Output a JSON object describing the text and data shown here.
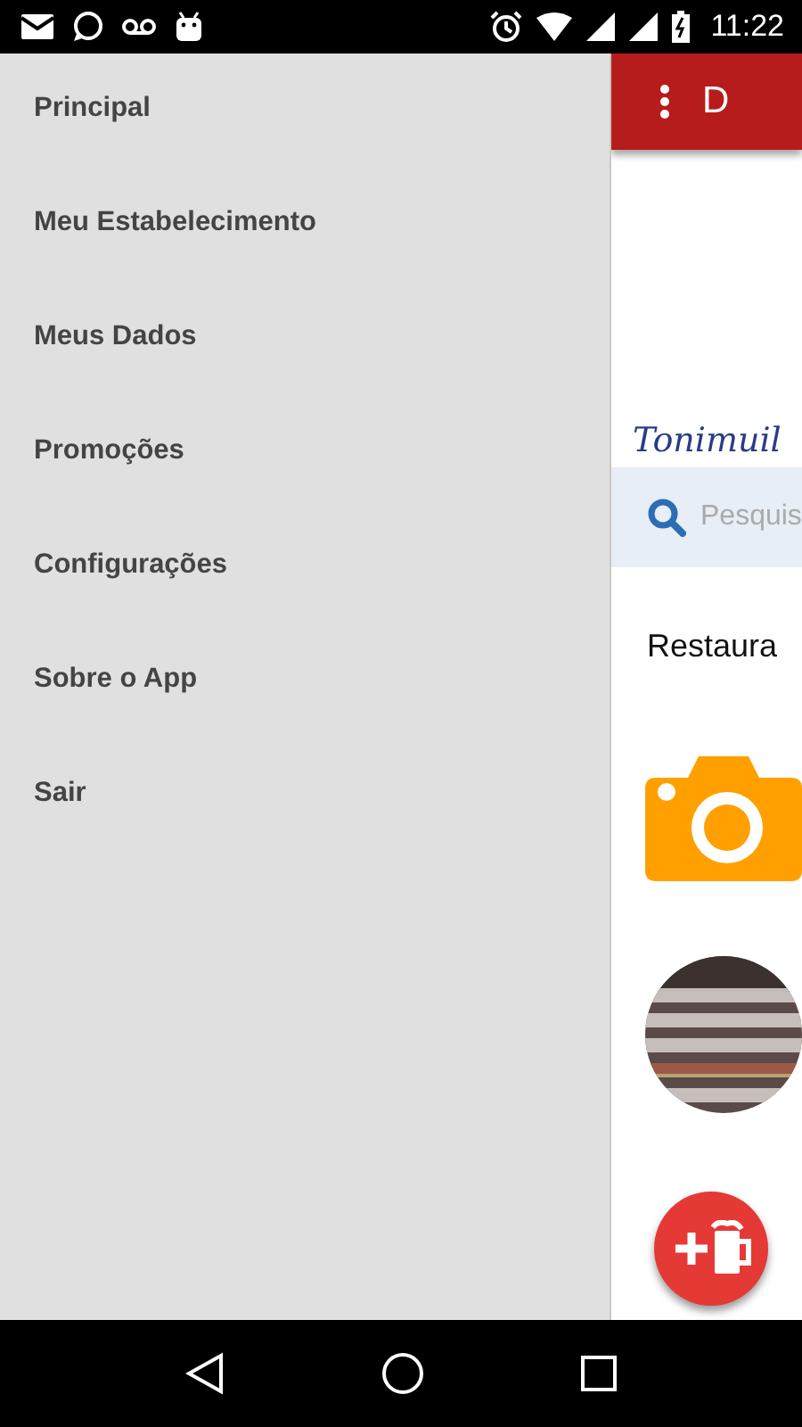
{
  "status_bar": {
    "time": "11:22"
  },
  "drawer": {
    "items": [
      {
        "label": "Principal"
      },
      {
        "label": "Meu Estabelecimento"
      },
      {
        "label": "Meus Dados"
      },
      {
        "label": "Promoções"
      },
      {
        "label": "Configurações"
      },
      {
        "label": "Sobre o App"
      },
      {
        "label": "Sair"
      }
    ]
  },
  "toolbar": {
    "title": "D"
  },
  "logo": {
    "text": "Tonimuil"
  },
  "search": {
    "placeholder": "Pesquis"
  },
  "section": {
    "title": "Restaura"
  },
  "list": [
    {
      "kind": "camera"
    },
    {
      "kind": "picture"
    }
  ]
}
